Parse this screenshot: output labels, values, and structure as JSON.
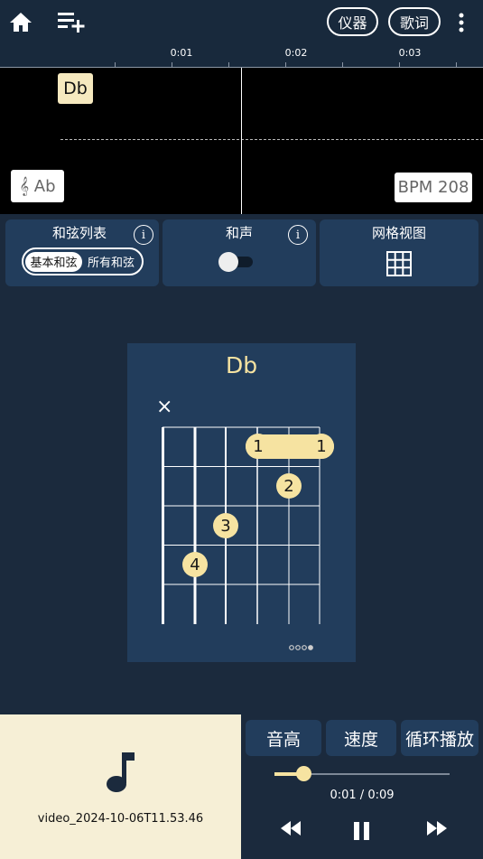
{
  "header": {
    "home_icon": "home-icon",
    "playlist_add_icon": "playlist-add-icon",
    "instrument_label": "仪器",
    "lyrics_label": "歌词",
    "more_icon": "more-vert-icon"
  },
  "timeline": {
    "marks": [
      "0:01",
      "0:02",
      "0:03"
    ]
  },
  "track": {
    "chord_label": "Db",
    "key_label": "𝄞 Ab",
    "bpm_label": "BPM 208"
  },
  "panels": {
    "chord_list": {
      "title": "和弦列表",
      "info": "i",
      "options": [
        "基本和弦",
        "所有和弦"
      ],
      "selected": "基本和弦"
    },
    "harmony": {
      "title": "和声",
      "info": "i",
      "toggle_on": false
    },
    "grid_view": {
      "title": "网格视图",
      "icon": "grid-icon"
    }
  },
  "chord_diagram": {
    "name": "Db",
    "muted_marker": "×",
    "fingers": [
      "1",
      "1",
      "2",
      "3",
      "4"
    ],
    "more_icon": "more-horiz-icon",
    "accent_color": "#f6e3a1"
  },
  "player": {
    "file_icon": "music-note-icon",
    "file_name": "video_2024-10-06T11.53.46",
    "buttons": {
      "pitch": "音高",
      "speed": "速度",
      "loop": "循环播放"
    },
    "time_display": "0:01 / 0:09",
    "progress": 0.15,
    "rewind_icon": "rewind-icon",
    "pause_icon": "pause-icon",
    "forward_icon": "fast-forward-icon"
  }
}
